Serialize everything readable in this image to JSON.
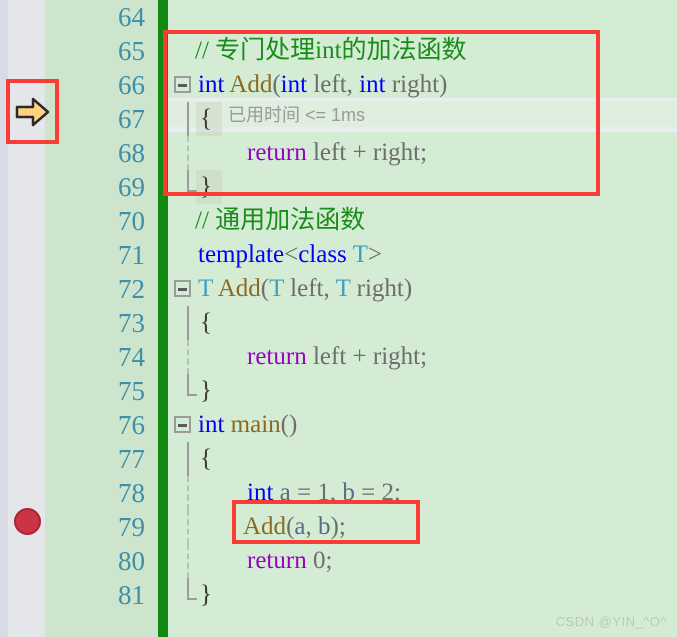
{
  "editor": {
    "first_line_number": 64,
    "colors": {
      "background": "#d4ecd4",
      "gutter": "#e5e6e9",
      "line_number_strip": "#cde5cd",
      "change_bar_green": "#108a10",
      "line_number_text": "#3f8fa8",
      "keyword_blue": "#0000ff",
      "function_brown": "#8a6a20",
      "comment_green": "#1a8c1a",
      "return_purple": "#9b00c8",
      "type_teal": "#3f9fc0",
      "identifier_gray": "#6d6d6d",
      "annotation_red": "#fa3c36",
      "breakpoint_red": "#cc3344",
      "current_line_arrow_yellow": "#ffd27f"
    },
    "lines": [
      {
        "n": "64",
        "text": ""
      },
      {
        "n": "65",
        "text": "  // 专门处理int的加法函数"
      },
      {
        "n": "66",
        "text": "int Add(int left, int right)"
      },
      {
        "n": "67",
        "text": "  {"
      },
      {
        "n": "68",
        "text": "      return left + right;"
      },
      {
        "n": "69",
        "text": "  }"
      },
      {
        "n": "70",
        "text": "  // 通用加法函数"
      },
      {
        "n": "71",
        "text": "  template<class T>"
      },
      {
        "n": "72",
        "text": "T Add(T left, T right)"
      },
      {
        "n": "73",
        "text": "  {"
      },
      {
        "n": "74",
        "text": "      return left + right;"
      },
      {
        "n": "75",
        "text": "  }"
      },
      {
        "n": "76",
        "text": "int main()"
      },
      {
        "n": "77",
        "text": "  {"
      },
      {
        "n": "78",
        "text": "      int a = 1, b = 2;"
      },
      {
        "n": "79",
        "text": "      Add(a, b);"
      },
      {
        "n": "80",
        "text": "      return 0;"
      },
      {
        "n": "81",
        "text": "  }"
      }
    ],
    "tokens": {
      "comment_int_add": "// 专门处理int的加法函数",
      "comment_generic_add": "// 通用加法函数",
      "kw_int": "int",
      "kw_template": "template",
      "kw_class": "class",
      "kw_return": "return",
      "fn_add": "Add",
      "fn_main": "main",
      "type_T": "T",
      "param_left": "left",
      "param_right": "right",
      "var_a": "a",
      "var_b": "b",
      "num_0": "0",
      "num_1": "1",
      "num_2": "2",
      "plus": "+",
      "semicolon": ";",
      "comma": ",",
      "paren_open": "(",
      "paren_close": ")",
      "angle_open": "<",
      "angle_close": ">",
      "equals": "=",
      "brace_open": "{",
      "brace_close": "}"
    }
  },
  "codelens": {
    "label": "已用时间",
    "operator": "<=",
    "value": "1ms",
    "full_text": "已用时间 <= 1ms",
    "attached_to_line": "67"
  },
  "markers": {
    "current_statement_arrow": "current-statement-arrow",
    "breakpoint": "breakpoint-dot",
    "breakpoint_line": "79",
    "arrow_line": "67",
    "fold_icon": "fold-collapse-minus"
  },
  "annotations": [
    {
      "name": "int-add-overload-highlight",
      "target_lines": "65-69"
    },
    {
      "name": "add-call-highlight",
      "target_lines": "79"
    }
  ],
  "watermark": {
    "text": "CSDN @YIN_^O^"
  }
}
